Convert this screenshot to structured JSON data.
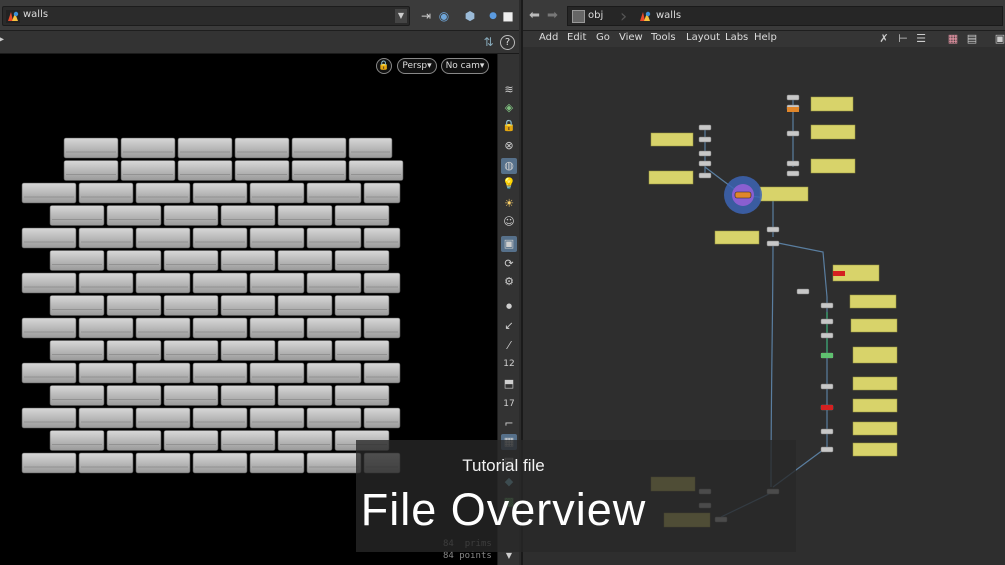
{
  "left": {
    "path_value": "walls",
    "viewport": {
      "persp_label": "Persp",
      "cam_label": "No cam"
    },
    "stats": {
      "prims_value": "84",
      "prims_label": "prims",
      "points_value": "84",
      "points_label": "points"
    },
    "toolbar_icons": [
      "display-options-icon",
      "snapping-icon",
      "lock-icon",
      "ghost-icon",
      "shading-icon",
      "light-icon",
      "light-2-icon",
      "camera-icon",
      "viewport-active-icon",
      "handle-icon",
      "pose-icon",
      "dot-icon",
      "arrow-icon",
      "line-icon",
      "number-icon",
      "cube-icon",
      "number-icon-2",
      "corner-icon",
      "grid-icon"
    ]
  },
  "right": {
    "crumb_root": "obj",
    "crumb_current": "walls",
    "menus": [
      "Add",
      "Edit",
      "Go",
      "View",
      "Tools",
      "Layout",
      "Labs",
      "Help"
    ]
  },
  "caption": {
    "subtitle": "Tutorial file",
    "title": "File Overview"
  },
  "colors": {
    "note_yellow": "#d8d36a",
    "node_red": "#d42020",
    "node_orange": "#e0862a",
    "selected_ring": "#3c64b4",
    "wire": "#5a7ea0"
  }
}
